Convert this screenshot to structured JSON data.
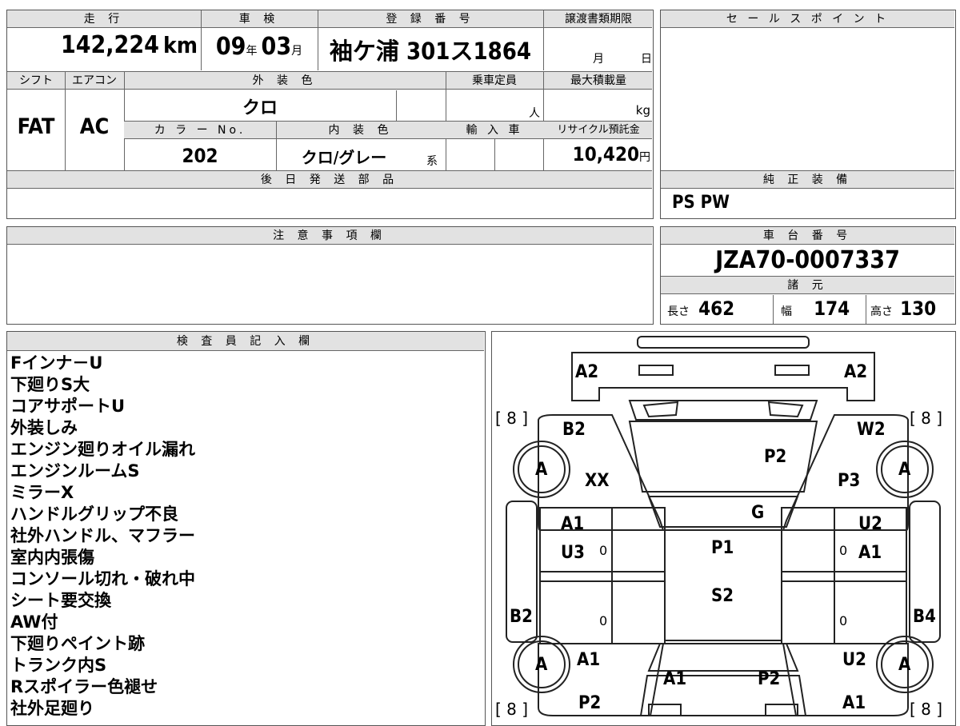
{
  "summary": {
    "mileage_label": "走 行",
    "mileage_value": "142,224",
    "mileage_unit": "km",
    "inspection_label": "車 検",
    "inspection_year": "09",
    "inspection_year_unit": "年",
    "inspection_month": "03",
    "inspection_month_unit": "月",
    "registration_label": "登 録 番 号",
    "registration_value": "袖ケ浦 301ス1864",
    "transfer_label": "譲渡書類期限",
    "transfer_month_unit": "月",
    "transfer_day_unit": "日",
    "shift_label": "シフト",
    "shift_value": "FAT",
    "ac_label": "エアコン",
    "ac_value": "AC",
    "exterior_color_label": "外 装 色",
    "exterior_color_value": "クロ",
    "capacity_label": "乗車定員",
    "capacity_unit": "人",
    "max_load_label": "最大積載量",
    "max_load_unit": "kg",
    "color_no_label": "カ ラ ー No.",
    "color_no_value": "202",
    "interior_color_label": "内 装 色",
    "interior_color_value": "クロ/グレー",
    "interior_color_suffix": "系",
    "import_label": "輸 入 車",
    "recycle_label": "リサイクル預託金",
    "recycle_value": "10,420",
    "recycle_unit": "円",
    "later_parts_label": "後 日 発 送 部 品"
  },
  "sales_point": {
    "label": "セ ー ル ス ポ イ ン ト"
  },
  "genuine_equipment": {
    "label": "純 正 装 備",
    "value": "PS PW"
  },
  "caution": {
    "label": "注 意 事 項 欄"
  },
  "chassis": {
    "label": "車 台 番 号",
    "value": "JZA70-0007337"
  },
  "specs": {
    "label": "諸 元",
    "length_label": "長さ",
    "length_value": "462",
    "width_label": "幅",
    "width_value": "174",
    "height_label": "高さ",
    "height_value": "130"
  },
  "inspector": {
    "label": "検 査 員 記 入 欄",
    "notes": [
      "Fインナ－U",
      "下廻りS大",
      "コアサポートU",
      "外装しみ",
      "エンジン廻りオイル漏れ",
      "エンジンルームS",
      "ミラーX",
      "ハンドルグリップ不良",
      "社外ハンドル、マフラー",
      "室内内張傷",
      "コンソール切れ・破れ中",
      "シート要交換",
      "AW付",
      "下廻りペイント跡",
      "トランク内S",
      "Rスポイラー色褪せ",
      "社外足廻り"
    ]
  },
  "diagram": {
    "marks": {
      "a2_left": "A2",
      "a2_right": "A2",
      "b2_top": "B2",
      "w2": "W2",
      "xx": "XX",
      "p2_hood": "P2",
      "p3": "P3",
      "g": "G",
      "a1_left_door": "A1",
      "u2_right": "U2",
      "u3": "U3",
      "p1": "P1",
      "a1_right_door": "A1",
      "s2": "S2",
      "b2_side": "B2",
      "b4": "B4",
      "a1_rear_left": "A1",
      "u2_rear_right": "U2",
      "a1_trunk_left": "A1",
      "p2_trunk_right": "P2",
      "p2_bottom": "P2",
      "a1_bottom_right": "A1",
      "tire_tl": "A",
      "tire_tr": "A",
      "tire_bl": "A",
      "tire_br": "A",
      "tread_tl": "[ 8 ]",
      "tread_tr": "[ 8 ]",
      "tread_bl": "[ 8 ]",
      "tread_br": "[ 8 ]",
      "zero": "0"
    }
  }
}
